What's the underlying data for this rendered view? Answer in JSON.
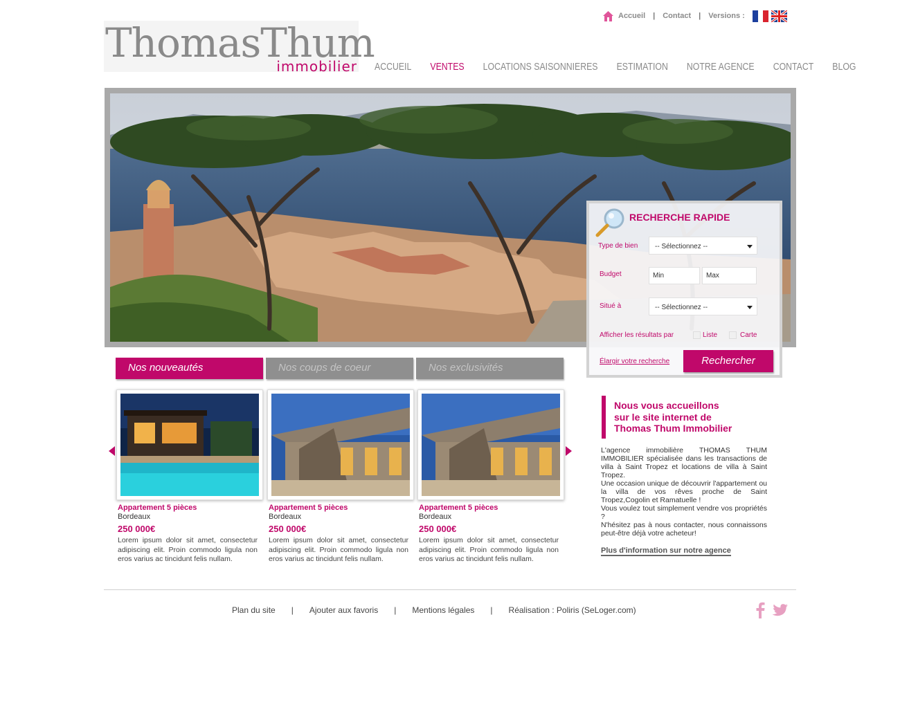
{
  "logo": {
    "main": "ThomasThum",
    "sub": "immobilier"
  },
  "top_links": {
    "home": "Accueil",
    "contact": "Contact",
    "versions": "Versions :"
  },
  "nav": {
    "items": [
      "ACCUEIL",
      "VENTES",
      "LOCATIONS SAISONNIERES",
      "ESTIMATION",
      "NOTRE AGENCE",
      "CONTACT",
      "BLOG"
    ],
    "active": "VENTES"
  },
  "search": {
    "title": "RECHERCHE RAPIDE",
    "type_label": "Type de bien",
    "type_value": "-- Sélectionnez --",
    "budget_label": "Budget",
    "budget_min": "Min",
    "budget_max": "Max",
    "location_label": "Situé à",
    "location_value": "-- Sélectionnez --",
    "display_label": "Afficher les résultats par",
    "option_list": "Liste",
    "option_map": "Carte",
    "widen_link": "Élargir votre recherche",
    "submit": "Rechercher"
  },
  "tabs": [
    "Nos nouveautés",
    "Nos coups de coeur",
    "Nos exclusivités"
  ],
  "listings": [
    {
      "title": "Appartement 5 pièces",
      "city": "Bordeaux",
      "price": "250 000€",
      "desc": "Lorem ipsum dolor sit amet, consectetur adipiscing elit. Proin commodo ligula non eros varius ac tincidunt felis nullam."
    },
    {
      "title": "Appartement 5 pièces",
      "city": "Bordeaux",
      "price": "250 000€",
      "desc": "Lorem ipsum dolor sit amet, consectetur adipiscing elit. Proin commodo ligula non eros varius ac tincidunt felis nullam."
    },
    {
      "title": "Appartement 5 pièces",
      "city": "Bordeaux",
      "price": "250 000€",
      "desc": "Lorem ipsum dolor sit amet, consectetur adipiscing elit. Proin commodo ligula non eros varius ac tincidunt felis nullam."
    }
  ],
  "welcome": {
    "title_l1": "Nous vous accueillons",
    "title_l2": "sur le site internet de",
    "title_l3": "Thomas Thum Immobilier",
    "p1": "L'agence immobilière THOMAS THUM IMMOBILIER spécialisée dans les transactions de villa à Saint Tropez et locations de villa à Saint Tropez.",
    "p2": "Une occasion unique de découvrir l'appartement ou la villa de vos rêves proche de Saint Tropez,Cogolin et Ramatuelle !",
    "p3": "Vous voulez tout simplement vendre vos propriétés ?",
    "p4": "N'hésitez pas à nous contacter, nous connaissons peut-être déjà votre acheteur!",
    "link": "Plus d'information sur notre agence"
  },
  "footer": {
    "sitemap": "Plan du site",
    "favorites": "Ajouter aux favoris",
    "legal": "Mentions légales",
    "credits": "Réalisation : Poliris (SeLoger.com)"
  },
  "colors": {
    "accent": "#c0086a",
    "tab_inactive": "#8f8f8f",
    "nav_text": "#8a8a8a"
  },
  "icons": [
    "home-icon",
    "flag-fr-icon",
    "flag-uk-icon",
    "magnifier-icon",
    "chevron-down-icon",
    "arrow-left-icon",
    "arrow-right-icon",
    "facebook-icon",
    "twitter-icon"
  ]
}
